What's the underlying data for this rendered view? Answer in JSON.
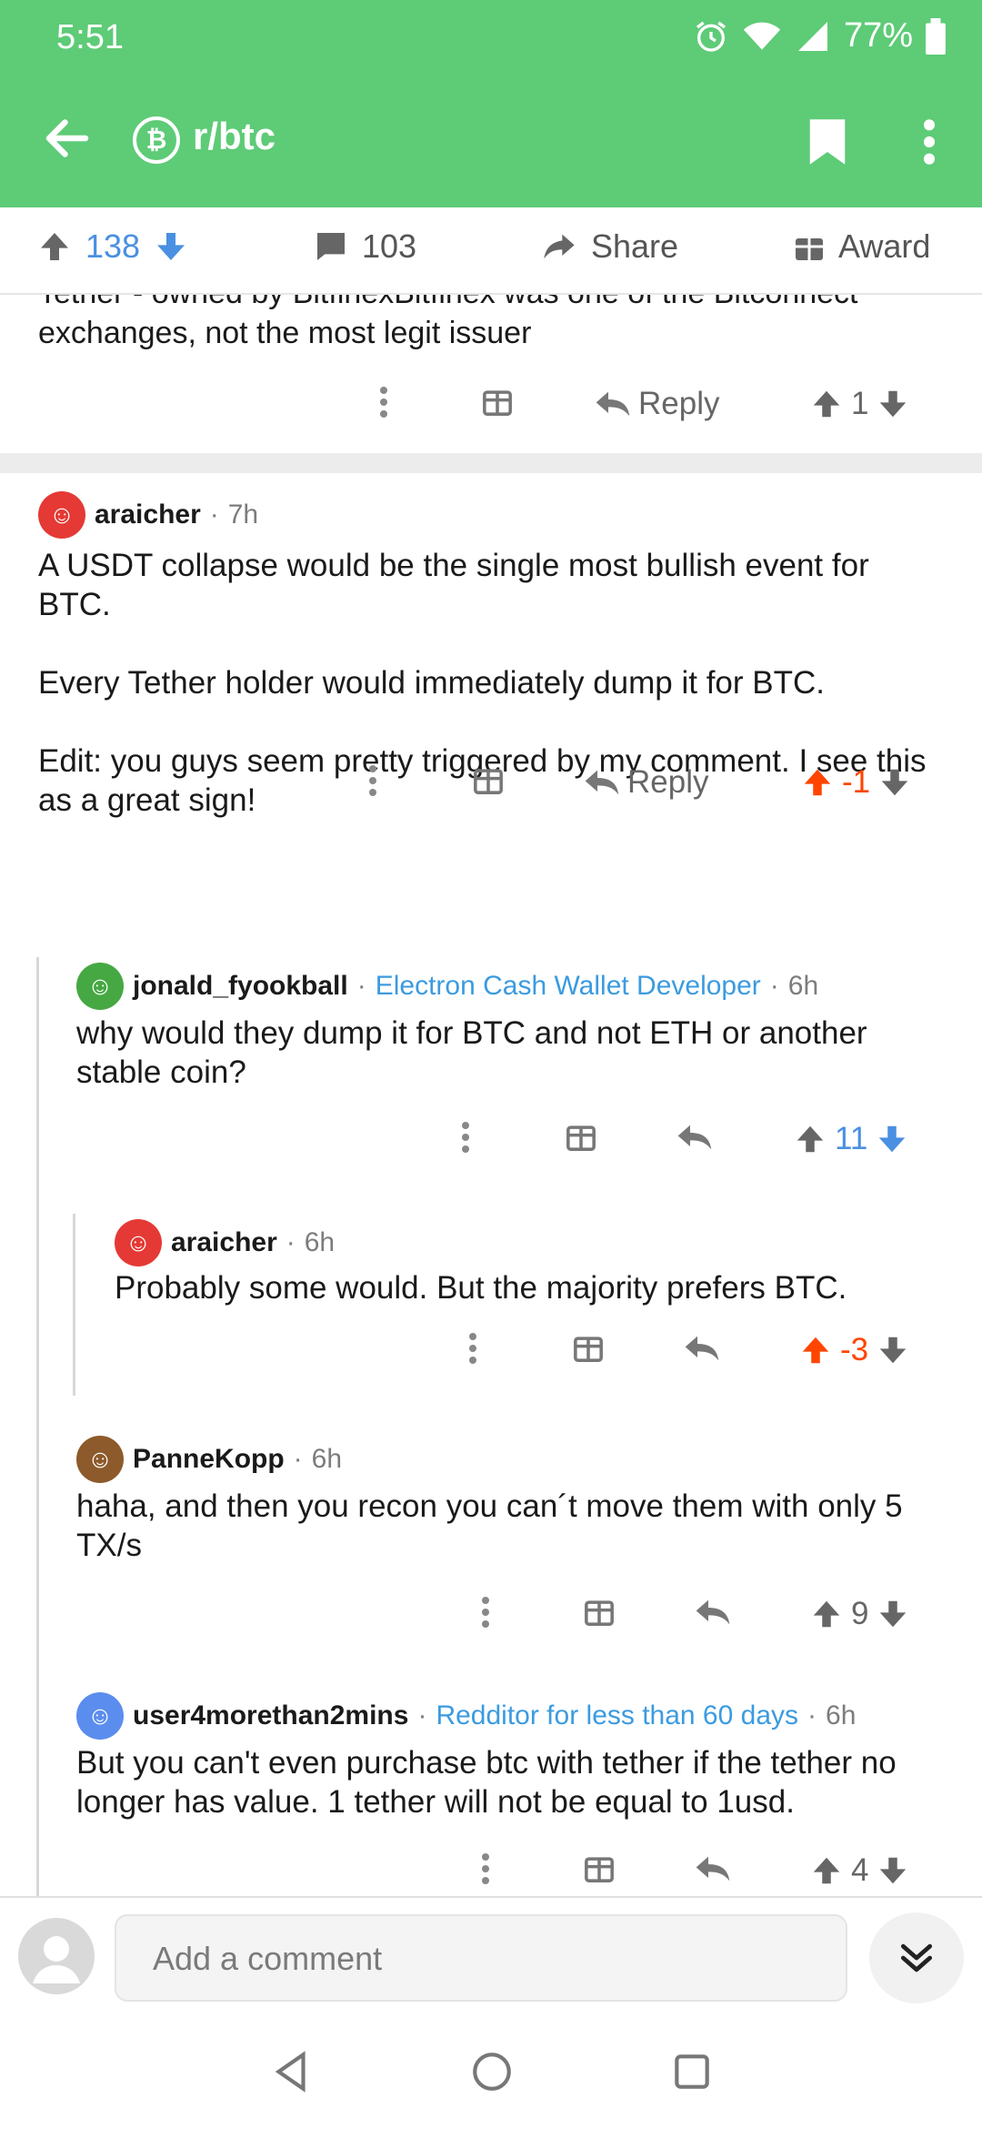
{
  "status": {
    "time": "5:51",
    "battery": "77%"
  },
  "header": {
    "subreddit": "r/btc",
    "sub_icon_glyph": "₿"
  },
  "postbar": {
    "upvotes": "138",
    "comments": "103",
    "share": "Share",
    "award": "Award"
  },
  "cut_comment": {
    "text": "Tether - owned by BitfinexBitfinex was one of the Bitconnect exchanges, not the most legit issuer",
    "reply": "Reply",
    "score": "1"
  },
  "comments": [
    {
      "author": "araicher",
      "time": "7h",
      "flair": "",
      "body": "A USDT collapse would be the single most bullish event for BTC.\n\nEvery Tether holder would immediately dump it for BTC.\n\nEdit: you guys seem pretty triggered by my comment. I see this as a great sign!",
      "reply": "Reply",
      "score": "-1"
    },
    {
      "author": "jonald_fyookball",
      "time": "6h",
      "flair": "Electron Cash Wallet Developer",
      "body": "why would they dump it for BTC and not ETH or another stable coin?",
      "score": "11"
    },
    {
      "author": "araicher",
      "time": "6h",
      "flair": "",
      "body": "Probably some would. But the majority prefers BTC.",
      "score": "-3"
    },
    {
      "author": "PanneKopp",
      "time": "6h",
      "flair": "",
      "body": "haha, and then you recon you can´t move them with only 5 TX/s",
      "score": "9"
    },
    {
      "author": "user4morethan2mins",
      "time": "6h",
      "flair": "Redditor for less than 60 days",
      "body": "But you can't even purchase btc with tether if the tether no longer has value. 1 tether will not be equal to 1usd.",
      "score": "4"
    }
  ],
  "composer": {
    "placeholder": "Add a comment"
  },
  "colors": {
    "app_green": "#5ecb77",
    "upvote_orange": "#ff4500",
    "vote_blue": "#4a90e2",
    "flair_blue": "#3b9be0"
  }
}
